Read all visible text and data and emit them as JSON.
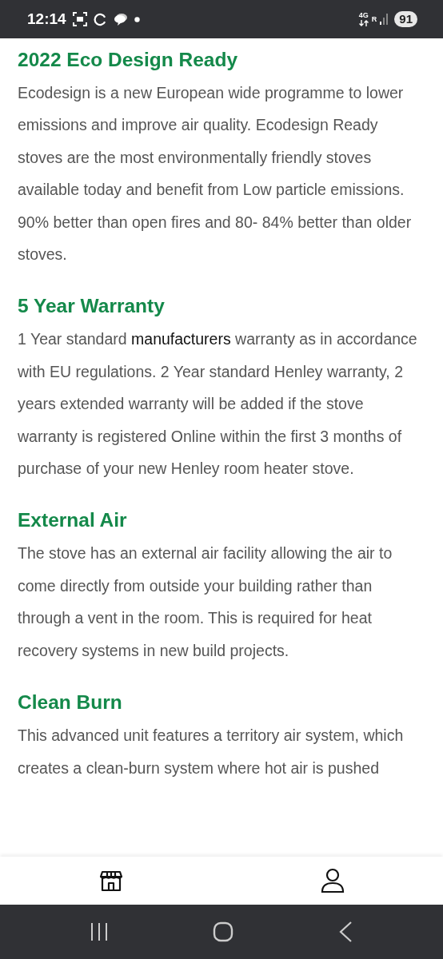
{
  "status_bar": {
    "time": "12:14",
    "network": "4G",
    "roaming": "R",
    "battery": "91"
  },
  "sections": [
    {
      "heading": "2022 Eco Design Ready",
      "body": "Ecodesign is a new European wide programme to lower emissions and improve air quality. Ecodesign Ready stoves are the most environmentally friendly stoves available today and benefit from Low particle emissions. 90% better than open fires and 80- 84% better than older stoves."
    },
    {
      "heading": "5 Year Warranty",
      "body": "1 Year standard **manufacturers** warranty as in accordance with EU regulations. 2 Year standard Henley warranty, 2 years extended warranty will be added if the stove warranty is registered Online within the first 3 months of purchase of your new Henley room heater stove."
    },
    {
      "heading": "External Air",
      "body": "The stove has an external air facility allowing the air to come directly from outside your building rather than through a vent in the room. This is required for heat recovery systems in new build projects."
    },
    {
      "heading": "Clean Burn",
      "body": "This advanced unit features a territory air system, which creates a clean-burn system where hot air is pushed"
    }
  ]
}
